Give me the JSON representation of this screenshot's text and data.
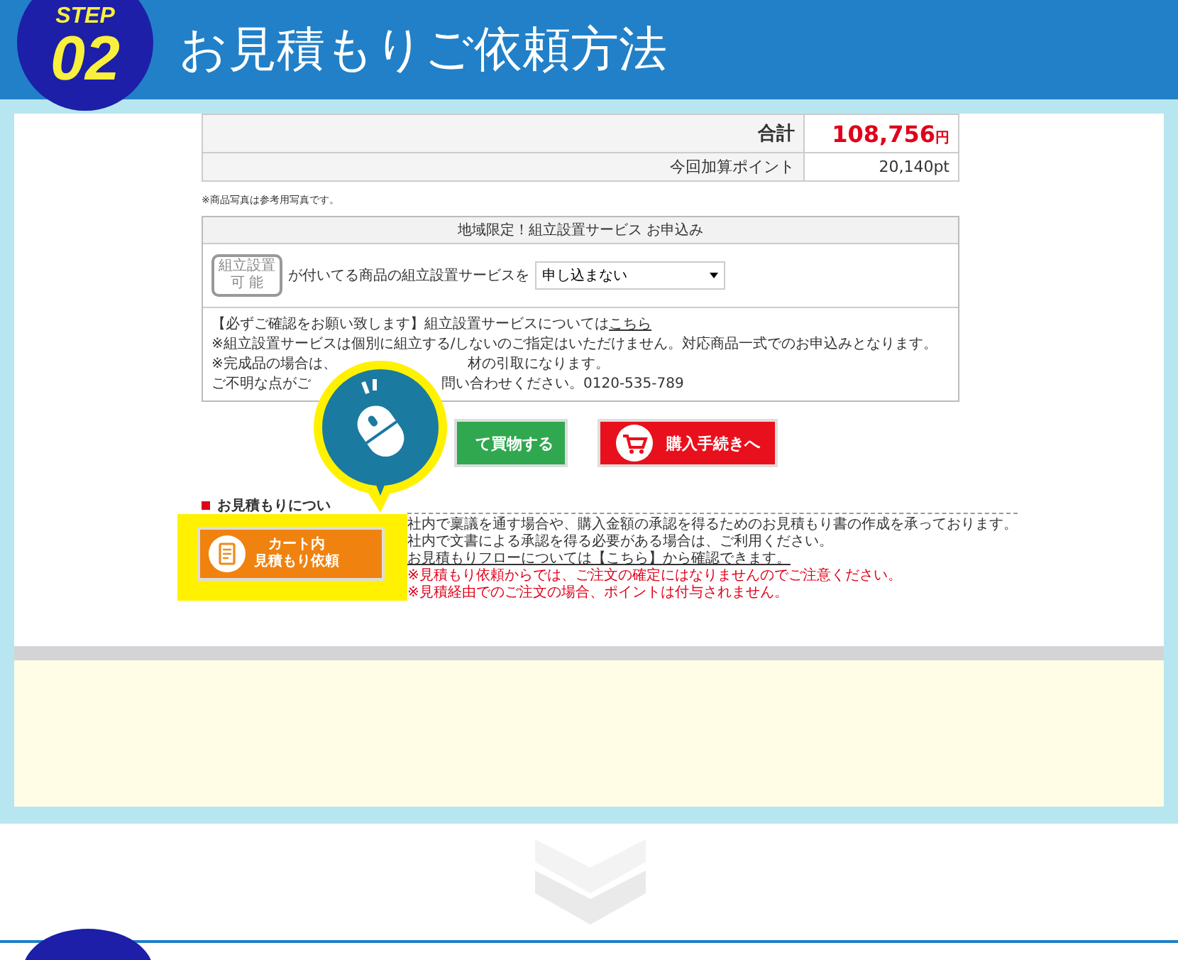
{
  "header": {
    "step_label": "STEP",
    "step_number": "02",
    "title": "お見積もりご依頼方法"
  },
  "totals": [
    {
      "kind": "total",
      "label": "合計",
      "value": "108,756",
      "unit": "円"
    },
    {
      "kind": "points",
      "label": "今回加算ポイント",
      "value": "20,140pt"
    }
  ],
  "photo_note": "※商品写真は参考用写真です。",
  "assembly": {
    "title": "地域限定！組立設置サービス お申込み",
    "badge_lines": [
      "組立設置",
      "可 能"
    ],
    "prompt": "が付いてる商品の組立設置サービスを",
    "select_value": "申し込まない",
    "notes": [
      {
        "segments": [
          "【必ずご確認をお願い致します】組立設置サービスについては"
        ],
        "link": "こちら"
      },
      {
        "segments": [
          "※組立設置サービスは個別に組立する/しないのご指定はいただけません。対応商品一式でのお申込みとなります。"
        ]
      },
      {
        "segments": [
          "※完成品の場合は、",
          "材の引取になります。"
        ]
      },
      {
        "segments": [
          "ご不明な点がご",
          "問い合わせください。0120-535-789"
        ]
      }
    ]
  },
  "buttons": [
    {
      "kind": "continue",
      "label": "て買物する"
    },
    {
      "kind": "checkout",
      "label": "購入手続きへ"
    }
  ],
  "estimate": {
    "heading": "お見積もりについ",
    "button_lines": [
      "カート内",
      "見積もり依頼"
    ],
    "highlighted": true,
    "lines": [
      {
        "kind": "plain",
        "text": "社内で稟議を通す場合や、購入金額の承認を得るためのお見積もり書の作成を承っております。"
      },
      {
        "kind": "plain",
        "text": "社内で文書による承認を得る必要がある場合は、ご利用ください。"
      },
      {
        "kind": "link",
        "text": "お見積もりフローについては【こちら】から確認できます。"
      },
      {
        "kind": "warning",
        "text": "※見積もり依頼からでは、ご注文の確定にはなりませんのでご注意ください。"
      },
      {
        "kind": "warning",
        "text": "※見積経由でのご注文の場合、ポイントは付与されません。"
      }
    ]
  }
}
